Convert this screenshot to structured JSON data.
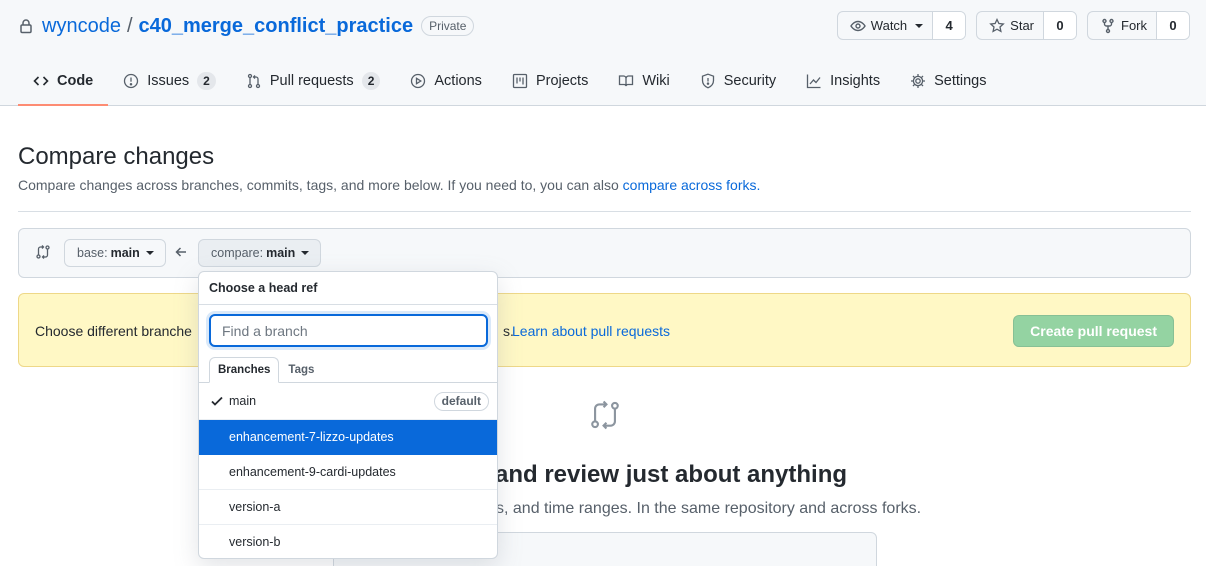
{
  "repo": {
    "owner": "wyncode",
    "separator": "/",
    "name": "c40_merge_conflict_practice",
    "visibility": "Private"
  },
  "actions": {
    "watch_label": "Watch",
    "watch_count": "4",
    "star_label": "Star",
    "star_count": "0",
    "fork_label": "Fork",
    "fork_count": "0"
  },
  "nav": {
    "code": "Code",
    "issues": "Issues",
    "issues_count": "2",
    "pull_requests": "Pull requests",
    "pull_requests_count": "2",
    "actions": "Actions",
    "projects": "Projects",
    "wiki": "Wiki",
    "security": "Security",
    "insights": "Insights",
    "settings": "Settings"
  },
  "compare": {
    "title": "Compare changes",
    "subtitle": "Compare changes across branches, commits, tags, and more below. If you need to, you can also ",
    "forks_link": "compare across forks.",
    "base_prefix": "base:",
    "base_value": "main",
    "compare_prefix": "compare:",
    "compare_value": "main"
  },
  "flash": {
    "text": "Choose different branches or forks above to discuss and propose changes.",
    "visible_text": "Choose different branche",
    "suffix": "s.",
    "learn_link": "Learn about pull requests",
    "create_button": "Create pull request"
  },
  "blankslate": {
    "title": "and review just about anything",
    "text": "s, and time ranges. In the same repository and across forks."
  },
  "dropdown": {
    "header": "Choose a head ref",
    "filter_placeholder": "Find a branch",
    "tabs": [
      "Branches",
      "Tags"
    ],
    "default_badge": "default",
    "branches": [
      {
        "name": "main",
        "checked": true,
        "default": true
      },
      {
        "name": "enhancement-7-lizzo-updates",
        "highlighted": true
      },
      {
        "name": "enhancement-9-cardi-updates"
      },
      {
        "name": "version-a"
      },
      {
        "name": "version-b"
      }
    ]
  },
  "colors": {
    "link": "#0969da",
    "selected_tab_underline": "#fd8c73",
    "flash_background": "#fff8c5",
    "create_button_disabled": "#94d3a2",
    "highlight": "#0969da"
  },
  "icons": [
    "lock-icon",
    "eye-icon",
    "star-icon",
    "fork-icon",
    "code-icon",
    "issue-icon",
    "pull-request-icon",
    "play-icon",
    "project-icon",
    "book-icon",
    "shield-icon",
    "graph-icon",
    "gear-icon",
    "compare-icon",
    "arrow-left-icon",
    "check-icon"
  ]
}
